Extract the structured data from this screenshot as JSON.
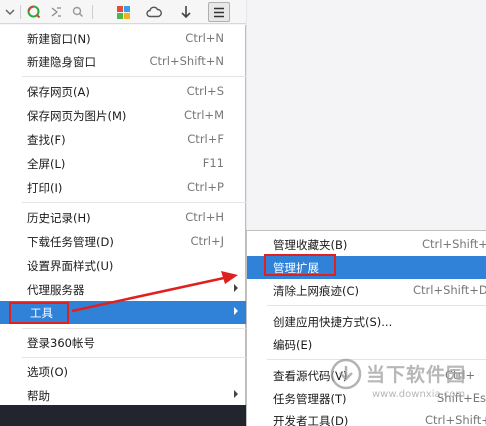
{
  "toolbar": {
    "icons": [
      "chevron-down-icon",
      "search-engine-icon",
      "tab-expand-icon",
      "search-icon",
      "apps-icon",
      "cloud-icon",
      "download-icon",
      "menu-icon"
    ]
  },
  "menu": {
    "items": [
      {
        "label": "新建窗口(N)",
        "shortcut": "Ctrl+N"
      },
      {
        "label": "新建隐身窗口",
        "shortcut": "Ctrl+Shift+N"
      },
      {
        "label": "保存网页(A)",
        "shortcut": "Ctrl+S"
      },
      {
        "label": "保存网页为图片(M)",
        "shortcut": "Ctrl+M"
      },
      {
        "label": "查找(F)",
        "shortcut": "Ctrl+F"
      },
      {
        "label": "全屏(L)",
        "shortcut": "F11"
      },
      {
        "label": "打印(I)",
        "shortcut": "Ctrl+P"
      },
      {
        "label": "历史记录(H)",
        "shortcut": "Ctrl+H"
      },
      {
        "label": "下载任务管理(D)",
        "shortcut": "Ctrl+J"
      },
      {
        "label": "设置界面样式(U)",
        "shortcut": ""
      },
      {
        "label": "代理服务器",
        "shortcut": ""
      },
      {
        "label": "工具",
        "shortcut": ""
      },
      {
        "label": "登录360帐号",
        "shortcut": ""
      },
      {
        "label": "选项(O)",
        "shortcut": ""
      },
      {
        "label": "帮助",
        "shortcut": ""
      }
    ]
  },
  "submenu": {
    "items": [
      {
        "label": "管理收藏夹(B)",
        "shortcut": "Ctrl+Shift+"
      },
      {
        "label": "管理扩展",
        "shortcut": ""
      },
      {
        "label": "清除上网痕迹(C)",
        "shortcut": "Ctrl+Shift+D"
      },
      {
        "label": "创建应用快捷方式(S)...",
        "shortcut": ""
      },
      {
        "label": "编码(E)",
        "shortcut": ""
      },
      {
        "label": "查看源代码(V)",
        "shortcut": "Ctrl+"
      },
      {
        "label": "任务管理器(T)",
        "shortcut": "Shift+Es"
      },
      {
        "label": "开发者工具(D)",
        "shortcut": "Ctrl+Shift+"
      }
    ]
  },
  "watermark": {
    "brand": "当下软件园",
    "url": "www.downxia.com"
  },
  "colors": {
    "highlight": "#2f82d8",
    "annotation_red": "#e0201e"
  }
}
